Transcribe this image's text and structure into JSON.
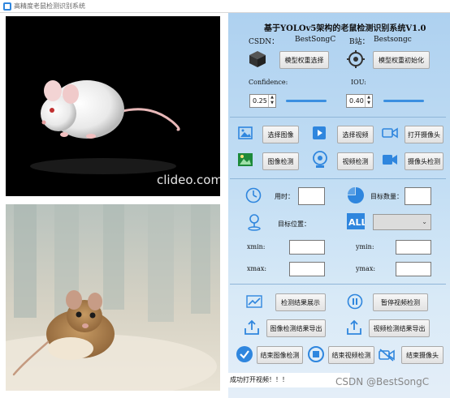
{
  "window": {
    "title": "高精度老鼠检测识别系统"
  },
  "images": {
    "top_watermark": "clideo.com"
  },
  "header": {
    "title": "基于YOLOv5架构的老鼠检测识别系统V1.0",
    "csdn_label": "CSDN：",
    "csdn_value": "BestSongC",
    "bilibili_label": "B站：",
    "bilibili_value": "Bestsongc"
  },
  "model": {
    "select_weights_button": "模型权重选择",
    "init_weights_button": "模型权重初始化"
  },
  "params": {
    "confidence_label": "Confidence:",
    "confidence_value": "0.25",
    "confidence_fraction": 0.25,
    "iou_label": "IOU:",
    "iou_value": "0.40",
    "iou_fraction": 0.4
  },
  "sources": {
    "select_image": "选择图像",
    "select_video": "选择视频",
    "open_camera": "打开摄像头",
    "image_detect": "图像检测",
    "video_detect": "视频检测",
    "camera_detect": "摄像头检测"
  },
  "results": {
    "time_label": "用时：",
    "time_value": "",
    "count_label": "目标数量：",
    "count_value": "",
    "position_label": "目标位置：",
    "select_value": "",
    "xmin_label": "xmin:",
    "ymin_label": "ymin:",
    "xmax_label": "xmax:",
    "ymax_label": "ymax:"
  },
  "actions": {
    "show_results": "检测结果展示",
    "pause_video": "暂停视频检测",
    "export_image": "图像检测结果导出",
    "export_video": "视频检测结果导出",
    "end_image": "结束图像检测",
    "end_video": "结束视频检测",
    "end_camera": "结束摄像头"
  },
  "status": {
    "message": "成功打开视频！！！"
  },
  "watermark": "CSDN @BestSongC",
  "colors": {
    "accent": "#2f86de",
    "panel_top": "#aed1f0",
    "panel_bottom": "#e4eef8"
  }
}
